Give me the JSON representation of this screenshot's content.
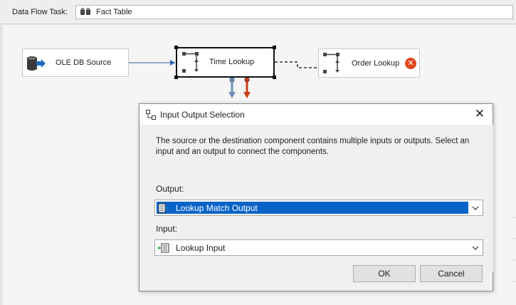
{
  "task_bar": {
    "label": "Data Flow Task:",
    "selected_task": "Fact Table",
    "task_icon": "data-flow-icon"
  },
  "canvas": {
    "components": [
      {
        "id": "oledb",
        "label": "OLE DB Source",
        "icon": "database-source-icon"
      },
      {
        "id": "time",
        "label": "Time Lookup",
        "icon": "lookup-icon",
        "selected": true
      },
      {
        "id": "order",
        "label": "Order Lookup",
        "icon": "lookup-icon",
        "status_icon": "error-icon"
      }
    ],
    "connector_colors": {
      "data": "#6d90b7",
      "error": "#c8401b"
    }
  },
  "dialog": {
    "title": "Input Output Selection",
    "title_icon": "input-output-icon",
    "message": "The source or the destination component contains multiple inputs or outputs. Select an input and an output to connect the components.",
    "output_label": "Output:",
    "output_value": "Lookup Match Output",
    "output_icon": "output-icon",
    "input_label": "Input:",
    "input_value": "Lookup Input",
    "input_icon": "input-icon",
    "ok_label": "OK",
    "cancel_label": "Cancel",
    "close_glyph": "✕",
    "accent_color": "#0a64c8"
  }
}
